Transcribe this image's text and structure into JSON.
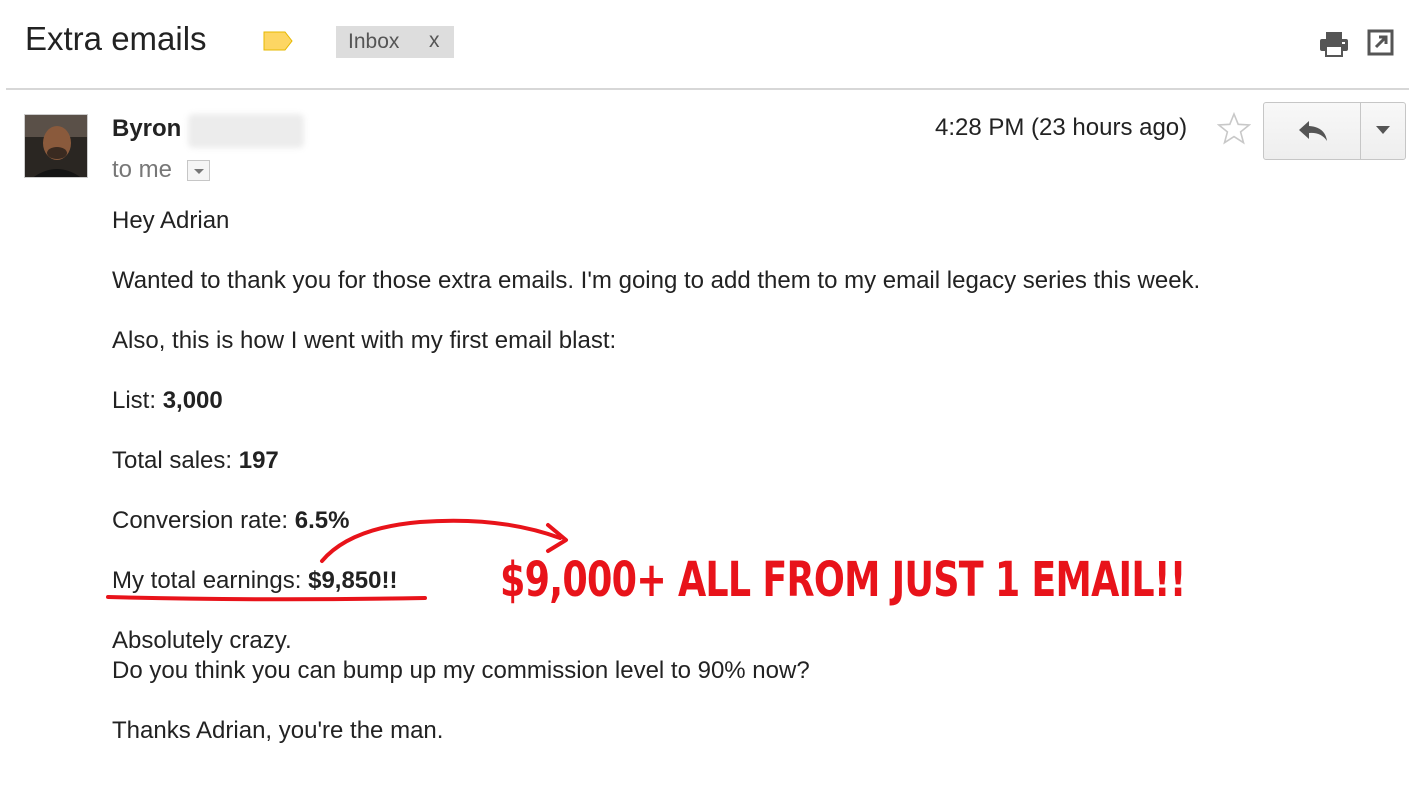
{
  "thread": {
    "subject": "Extra emails",
    "label_icon": "label-tag-icon",
    "label_color": "#fdd663",
    "chip": {
      "label": "Inbox",
      "remove": "x"
    },
    "actions": [
      "print-icon",
      "popout-icon"
    ]
  },
  "message": {
    "sender_first_name": "Byron",
    "recipient": "to me",
    "time": "4:28 PM (23 hours ago)",
    "icons": [
      "star-icon",
      "reply-icon",
      "chevron-down-icon"
    ]
  },
  "body": {
    "greeting": "Hey Adrian",
    "line1": "Wanted to thank you for those extra emails. I'm going to add them to my email legacy series this week.",
    "line2": "Also, this is how I went with my first email blast:",
    "list_label": "List:",
    "list_value": "3,000",
    "sales_label": "Total sales:",
    "sales_value": "197",
    "conversion_label": "Conversion rate:",
    "conversion_value": "6.5%",
    "earnings_label": "My total earnings:",
    "earnings_value": "$9,850!!",
    "line3": "Absolutely crazy.",
    "line4": "Do you think you can bump up my commission level to 90% now?",
    "closing": "Thanks Adrian, you're the man."
  },
  "annotation": {
    "text": "$9,000+ ALL FROM JUST 1 EMAIL!!",
    "color": "#e8131a"
  }
}
